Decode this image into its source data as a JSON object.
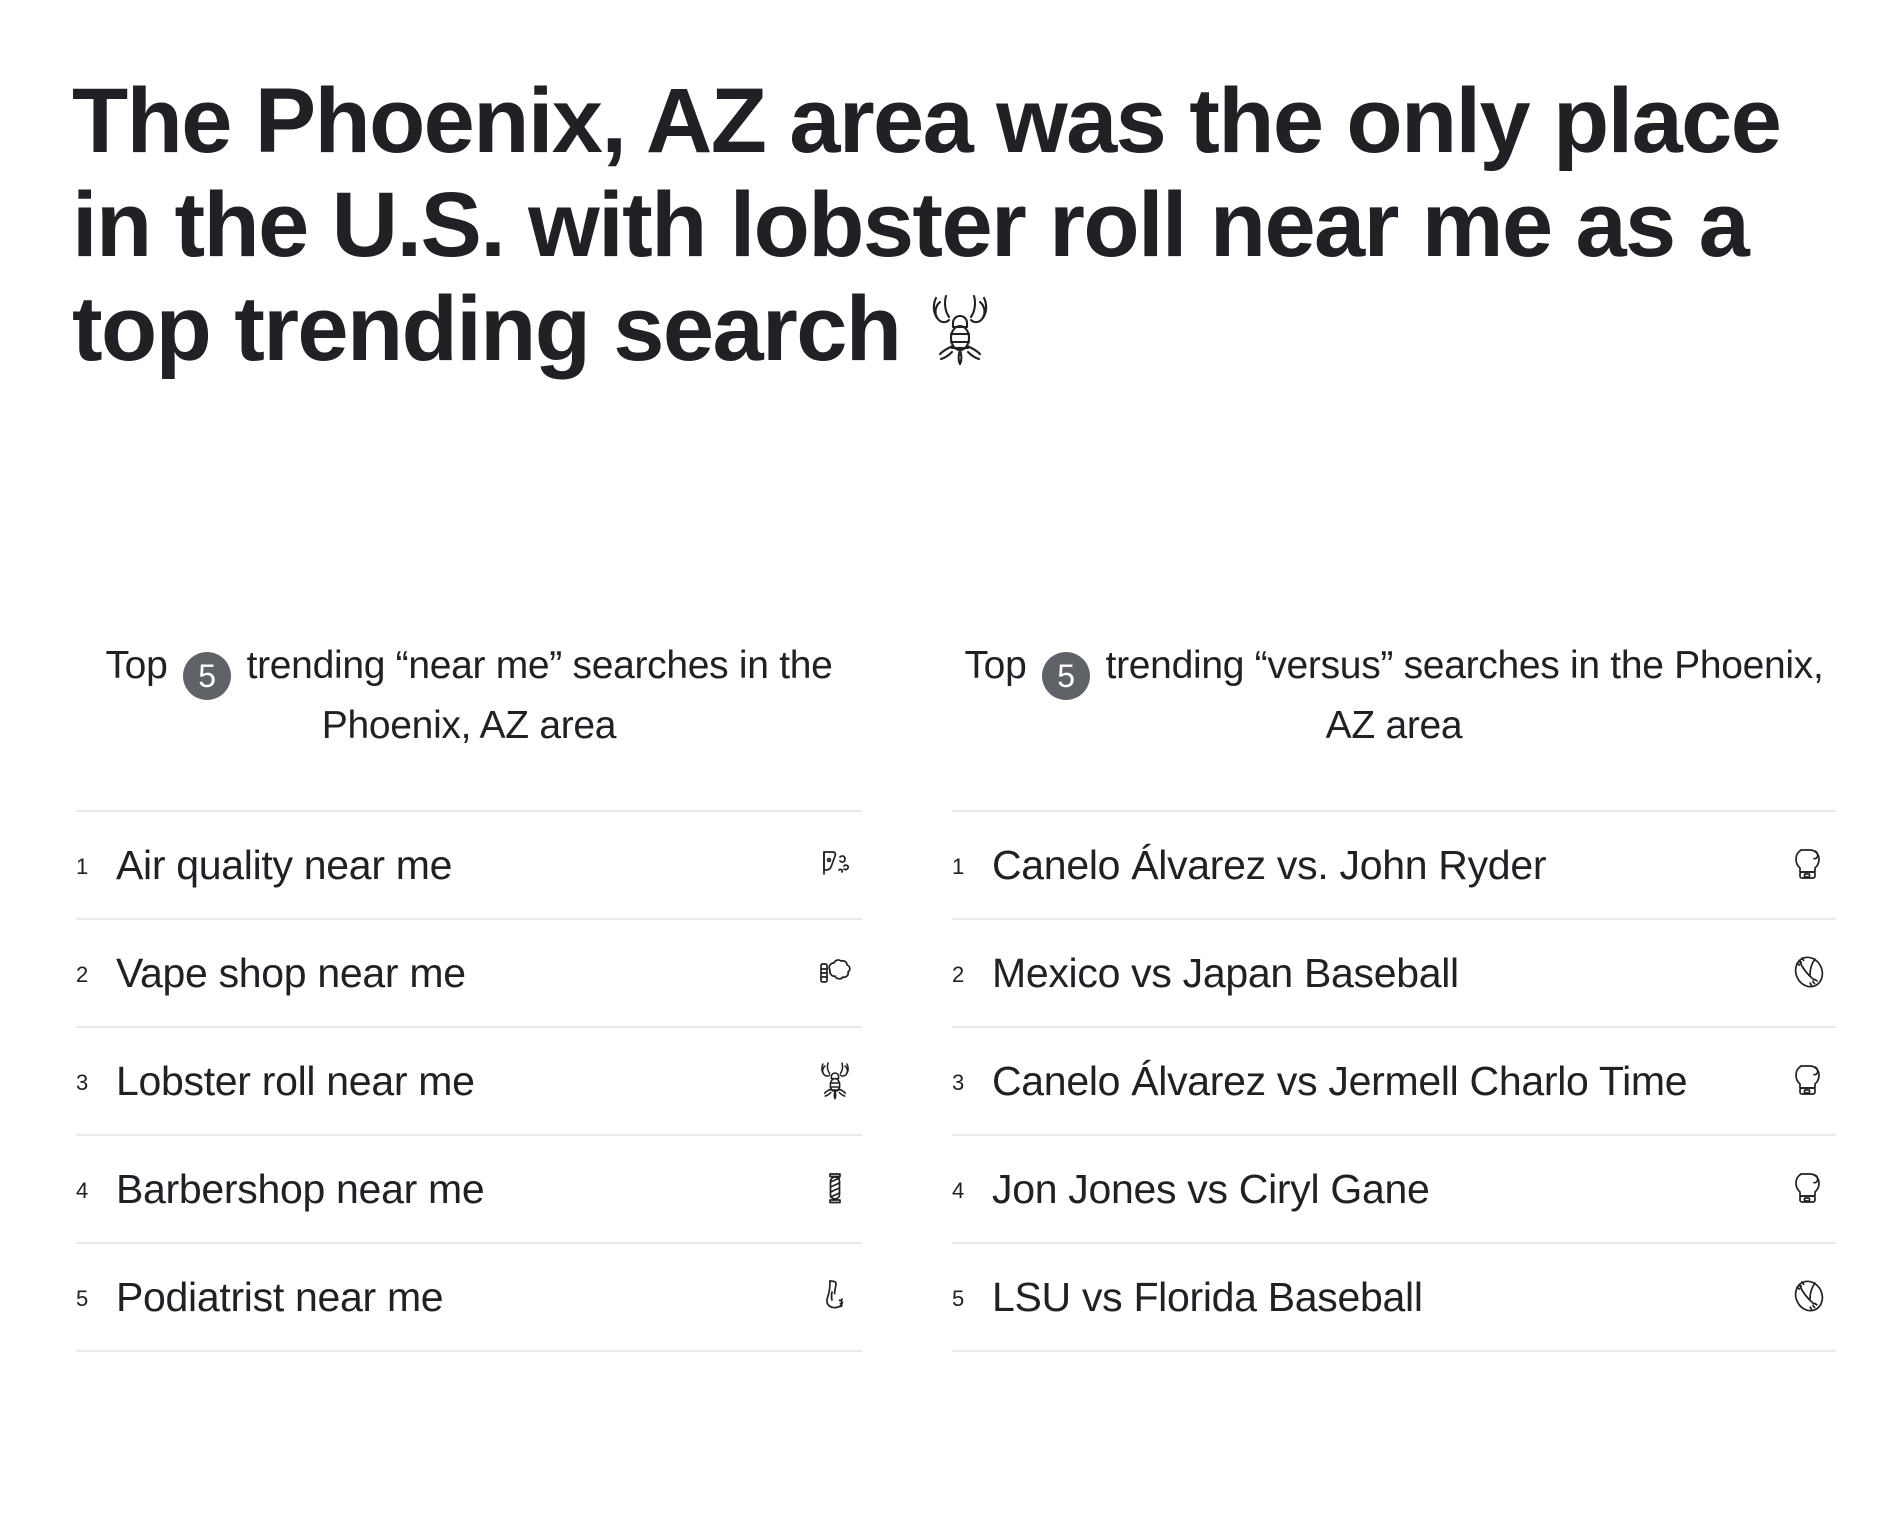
{
  "headline": {
    "part1": "The Phoenix, AZ area was the only place in the U.S. with ",
    "emphasis": "lobster roll near me",
    "part2": " as a top trending search",
    "emoji_name": "lobster-icon",
    "full_text": "The Phoenix, AZ area was the only place in the U.S. with lobster roll near me as a top trending search 🦞"
  },
  "columns": [
    {
      "title_prefix": "Top",
      "badge": "5",
      "title_suffix": "trending “near me” searches in the Phoenix, AZ area",
      "items": [
        {
          "rank": "1",
          "label": "Air quality near me",
          "icon": "wind-icon"
        },
        {
          "rank": "2",
          "label": "Vape shop near me",
          "icon": "smoke-cloud-icon"
        },
        {
          "rank": "3",
          "label": "Lobster roll near me",
          "icon": "lobster-icon"
        },
        {
          "rank": "4",
          "label": "Barbershop near me",
          "icon": "barber-pole-icon"
        },
        {
          "rank": "5",
          "label": "Podiatrist near me",
          "icon": "foot-icon"
        }
      ]
    },
    {
      "title_prefix": "Top",
      "badge": "5",
      "title_suffix": "trending “versus” searches in the Phoenix, AZ area",
      "items": [
        {
          "rank": "1",
          "label": "Canelo Álvarez vs. John Ryder",
          "icon": "boxing-glove-icon"
        },
        {
          "rank": "2",
          "label": "Mexico vs Japan Baseball",
          "icon": "baseball-icon"
        },
        {
          "rank": "3",
          "label": "Canelo Álvarez vs Jermell Charlo Time",
          "icon": "boxing-glove-icon"
        },
        {
          "rank": "4",
          "label": "Jon Jones vs Ciryl Gane",
          "icon": "boxing-glove-icon"
        },
        {
          "rank": "5",
          "label": "LSU vs Florida Baseball",
          "icon": "baseball-icon"
        }
      ]
    }
  ],
  "colors": {
    "text": "#202124",
    "badge_background": "#5f6368",
    "badge_text": "#ffffff",
    "divider": "#e8eaed",
    "background": "#ffffff"
  }
}
